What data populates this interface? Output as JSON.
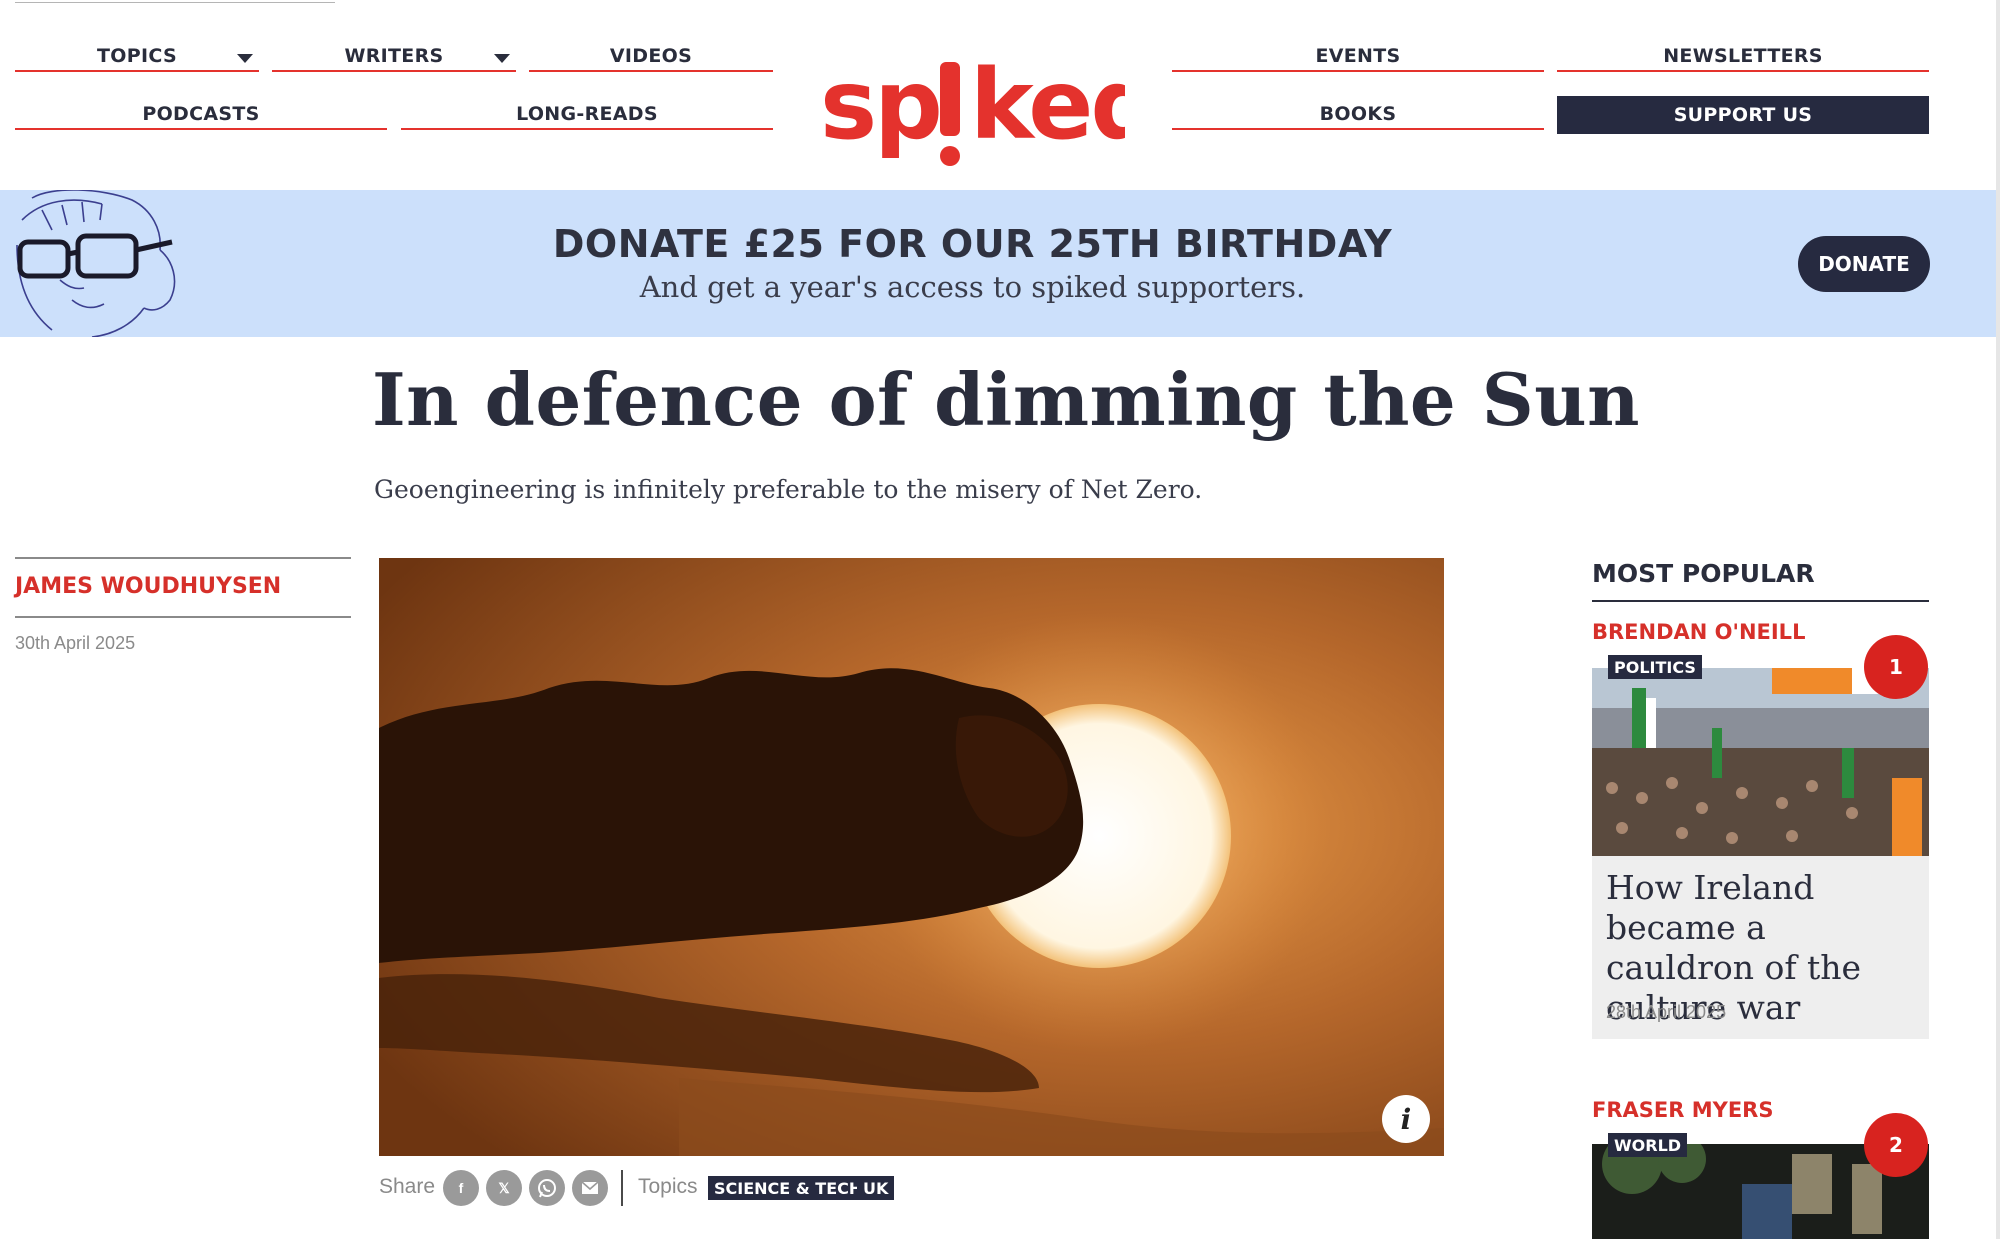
{
  "nav": {
    "row1_left": [
      {
        "label": "TOPICS",
        "dropdown": true
      },
      {
        "label": "WRITERS",
        "dropdown": true
      },
      {
        "label": "VIDEOS",
        "dropdown": false
      }
    ],
    "row2_left": [
      {
        "label": "PODCASTS"
      },
      {
        "label": "LONG-READS"
      }
    ],
    "row1_right": [
      {
        "label": "EVENTS"
      },
      {
        "label": "NEWSLETTERS"
      }
    ],
    "row2_right": [
      {
        "label": "BOOKS"
      },
      {
        "label": "SUPPORT US"
      }
    ]
  },
  "logo": {
    "text": "spiked",
    "color": "#e4322d"
  },
  "banner": {
    "title": "DONATE £25 FOR OUR 25TH BIRTHDAY",
    "subtitle": "And get a year's access to spiked supporters.",
    "button": "DONATE",
    "background": "#cce0fb"
  },
  "article": {
    "headline": "In defence of dimming the Sun",
    "standfirst": "Geoengineering is infinitely preferable to the misery of Net Zero.",
    "author": "JAMES WOUDHUYSEN",
    "date": "30th April 2025",
    "image_info_icon": "info-icon",
    "share_label": "Share",
    "share_icons": [
      "facebook-icon",
      "x-icon",
      "whatsapp-icon",
      "email-icon"
    ],
    "topics_label": "Topics",
    "tags": [
      "SCIENCE & TECH",
      "UK"
    ]
  },
  "most_popular": {
    "title": "MOST POPULAR",
    "items": [
      {
        "author": "BRENDAN O'NEILL",
        "category": "POLITICS",
        "rank": "1",
        "headline": "How Ireland became a cauldron of the culture war",
        "date": "28th April 2025"
      },
      {
        "author": "FRASER MYERS",
        "category": "WORLD",
        "rank": "2"
      }
    ]
  },
  "colors": {
    "accent_red": "#e4322d",
    "navy": "#262a40"
  }
}
